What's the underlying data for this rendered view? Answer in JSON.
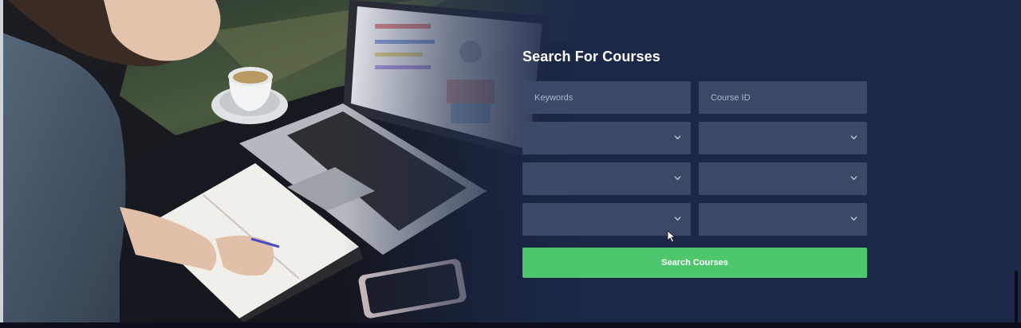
{
  "search_form": {
    "title": "Search For Courses",
    "keywords_placeholder": "Keywords",
    "course_id_placeholder": "Course ID",
    "dropdowns": [
      {
        "selected": ""
      },
      {
        "selected": ""
      },
      {
        "selected": ""
      },
      {
        "selected": ""
      },
      {
        "selected": ""
      },
      {
        "selected": ""
      }
    ],
    "submit_label": "Search Courses"
  },
  "colors": {
    "background": "#1c2847",
    "field": "#3b4866",
    "button": "#4dc66d",
    "text": "#ffffff"
  },
  "icons": {
    "dropdown": "chevron-down-icon",
    "cursor": "mouse-pointer-icon"
  }
}
